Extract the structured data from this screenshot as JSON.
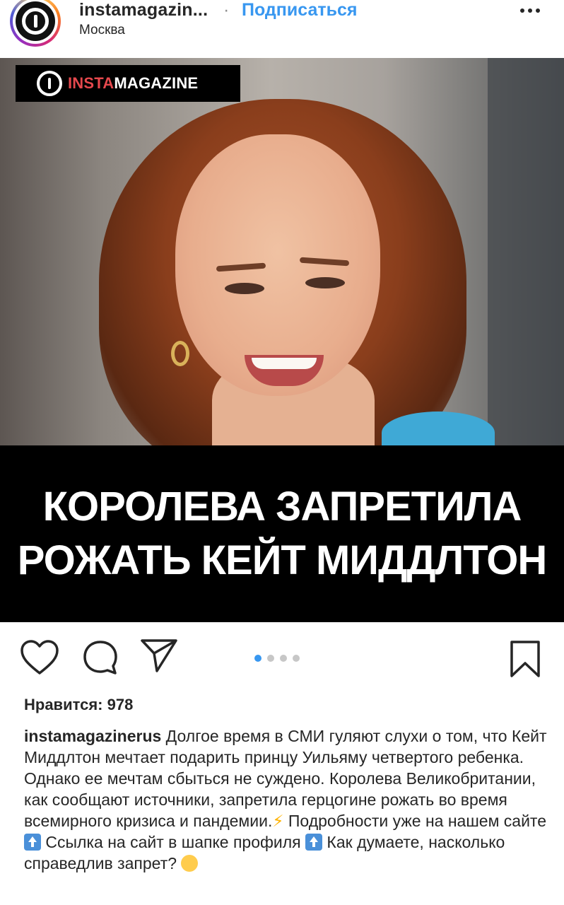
{
  "header": {
    "username": "instamagazin...",
    "separator": "·",
    "subscribe_label": "Подписаться",
    "location": "Москва",
    "more_icon": "more-horizontal-icon"
  },
  "post": {
    "logo_insta": "INSTA",
    "logo_magazine": "MAGAZINE",
    "headline_line1": "КОРОЛЕВА ЗАПРЕТИЛА",
    "headline_line2": "РОЖАТЬ КЕЙТ МИДДЛТОН",
    "carousel_count": 4,
    "carousel_active": 1
  },
  "actions": {
    "like_icon": "heart-icon",
    "comment_icon": "comment-icon",
    "share_icon": "send-icon",
    "save_icon": "bookmark-icon"
  },
  "likes": {
    "label": "Нравится: 978"
  },
  "caption": {
    "username": "instamagazinerus",
    "text_part1": " Долгое время в СМИ гуляют слухи о том, что Кейт Миддлтон мечтает подарить принцу Уильяму четвертого ребенка. Однако ее мечтам сбыться не суждено. Королева Великобритании, как сообщают источники, запретила герцогине рожать во время всемирного кризиса и пандемии.",
    "emoji1": "⚡",
    "text_part2": " Подробности уже на нашем сайте ",
    "text_part3": " Ссылка на сайт в шапке профиля ",
    "text_part4": " Как думаете, насколько справедлив запрет? ",
    "colors": {
      "link_blue": "#3897f0",
      "text": "#262626"
    }
  }
}
